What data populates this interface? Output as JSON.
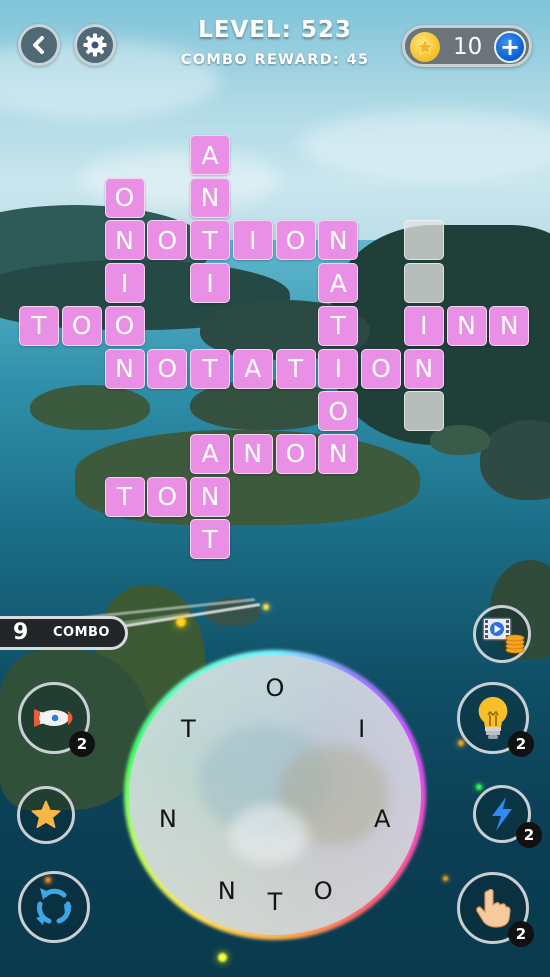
{
  "header": {
    "back_icon": "chevron-left-icon",
    "settings_icon": "gear-icon",
    "level_label": "LEVEL: 523",
    "combo_reward_label": "COMBO REWARD: 45",
    "coins": {
      "icon": "star-coin-icon",
      "count": "10",
      "add_icon": "plus-icon"
    }
  },
  "colors": {
    "tile_filled": "#ea8fe6",
    "tile_empty": "#e1e1e1",
    "coin_gold": "#f5c531",
    "plus_blue": "#0a5fd0",
    "combo_bg": "#232629"
  },
  "grid": {
    "columns": 12,
    "rows": 10,
    "cells": [
      {
        "r": 0,
        "c": 4,
        "letter": "A"
      },
      {
        "r": 1,
        "c": 2,
        "letter": "O"
      },
      {
        "r": 1,
        "c": 4,
        "letter": "N"
      },
      {
        "r": 2,
        "c": 2,
        "letter": "N"
      },
      {
        "r": 2,
        "c": 3,
        "letter": "O"
      },
      {
        "r": 2,
        "c": 4,
        "letter": "T"
      },
      {
        "r": 2,
        "c": 5,
        "letter": "I"
      },
      {
        "r": 2,
        "c": 6,
        "letter": "O"
      },
      {
        "r": 2,
        "c": 7,
        "letter": "N"
      },
      {
        "r": 2,
        "c": 9,
        "letter": ""
      },
      {
        "r": 3,
        "c": 2,
        "letter": "I"
      },
      {
        "r": 3,
        "c": 4,
        "letter": "I"
      },
      {
        "r": 3,
        "c": 7,
        "letter": "A"
      },
      {
        "r": 3,
        "c": 9,
        "letter": ""
      },
      {
        "r": 4,
        "c": 0,
        "letter": "T"
      },
      {
        "r": 4,
        "c": 1,
        "letter": "O"
      },
      {
        "r": 4,
        "c": 2,
        "letter": "O"
      },
      {
        "r": 4,
        "c": 7,
        "letter": "T"
      },
      {
        "r": 4,
        "c": 9,
        "letter": "I"
      },
      {
        "r": 4,
        "c": 10,
        "letter": "N"
      },
      {
        "r": 4,
        "c": 11,
        "letter": "N"
      },
      {
        "r": 5,
        "c": 2,
        "letter": "N"
      },
      {
        "r": 5,
        "c": 3,
        "letter": "O"
      },
      {
        "r": 5,
        "c": 4,
        "letter": "T"
      },
      {
        "r": 5,
        "c": 5,
        "letter": "A"
      },
      {
        "r": 5,
        "c": 6,
        "letter": "T"
      },
      {
        "r": 5,
        "c": 7,
        "letter": "I"
      },
      {
        "r": 5,
        "c": 8,
        "letter": "O"
      },
      {
        "r": 5,
        "c": 9,
        "letter": "N"
      },
      {
        "r": 6,
        "c": 7,
        "letter": "O"
      },
      {
        "r": 6,
        "c": 9,
        "letter": ""
      },
      {
        "r": 7,
        "c": 4,
        "letter": "A"
      },
      {
        "r": 7,
        "c": 5,
        "letter": "N"
      },
      {
        "r": 7,
        "c": 6,
        "letter": "O"
      },
      {
        "r": 7,
        "c": 7,
        "letter": "N"
      },
      {
        "r": 8,
        "c": 2,
        "letter": "T"
      },
      {
        "r": 8,
        "c": 3,
        "letter": "O"
      },
      {
        "r": 8,
        "c": 4,
        "letter": "N"
      },
      {
        "r": 9,
        "c": 4,
        "letter": "T"
      }
    ]
  },
  "combo": {
    "count": "9",
    "label": "COMBO"
  },
  "powerups": {
    "rocket": {
      "icon": "rocket-icon",
      "count": "2"
    },
    "star": {
      "icon": "star-icon"
    },
    "shuffle": {
      "icon": "shuffle-icon"
    },
    "video_coins": {
      "icon": "video-coins-icon"
    },
    "hint": {
      "icon": "lightbulb-icon",
      "count": "2"
    },
    "lightning": {
      "icon": "lightning-icon",
      "count": "2"
    },
    "finger": {
      "icon": "pointing-hand-icon",
      "count": "2"
    }
  },
  "wheel": {
    "letters": [
      {
        "letter": "O",
        "angle": 0
      },
      {
        "letter": "I",
        "angle": 52
      },
      {
        "letter": "A",
        "angle": 103
      },
      {
        "letter": "O",
        "angle": 154
      },
      {
        "letter": "T",
        "angle": 180
      },
      {
        "letter": "N",
        "angle": 206
      },
      {
        "letter": "N",
        "angle": 257
      },
      {
        "letter": "T",
        "angle": 308
      }
    ]
  }
}
